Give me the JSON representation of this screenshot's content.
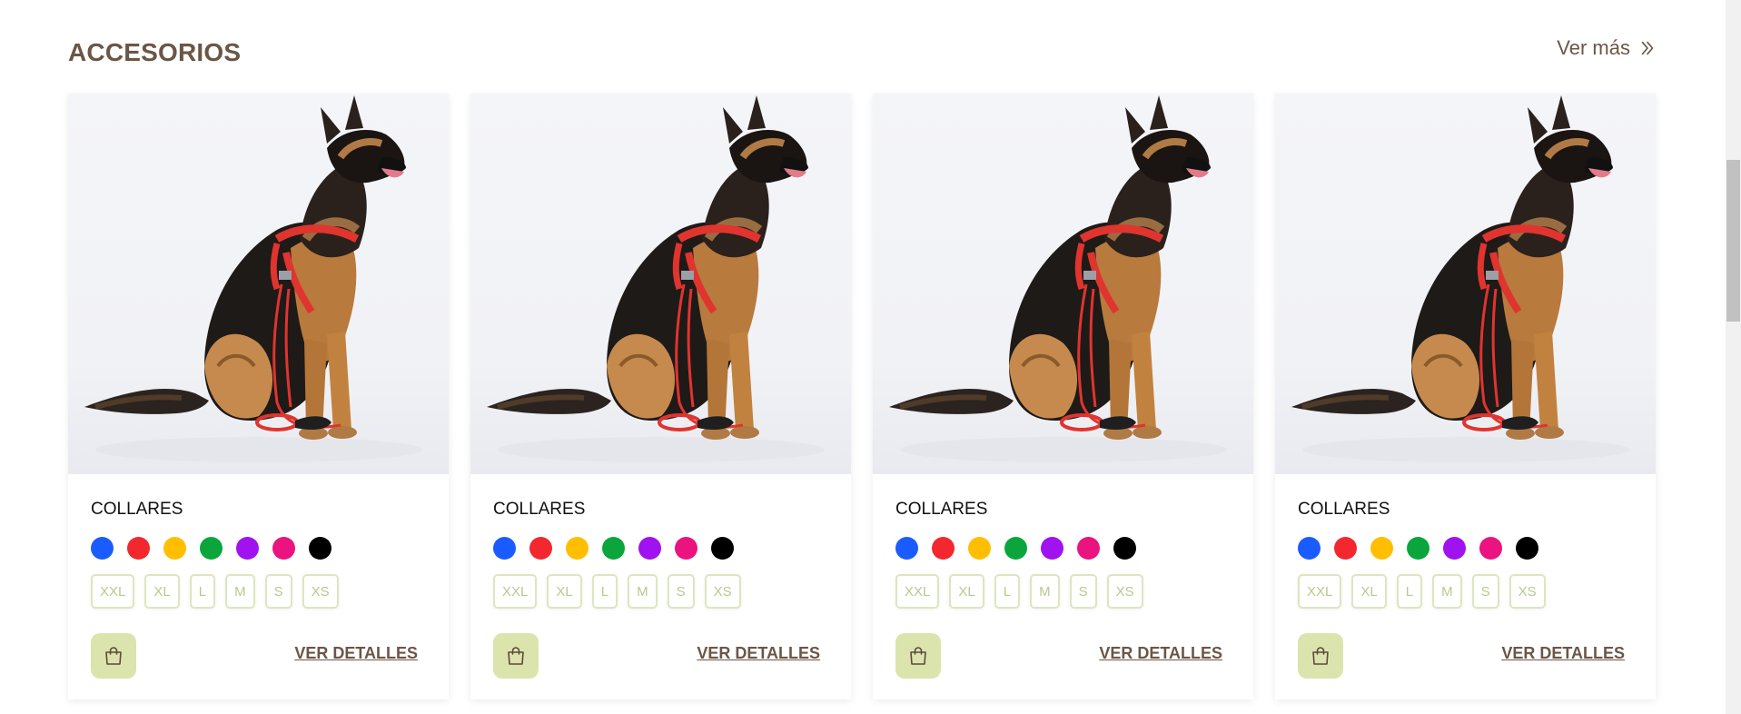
{
  "section": {
    "title": "ACCESORIOS",
    "see_more_label": "Ver más"
  },
  "colors": {
    "brand_brown": "#6b5646",
    "bag_button_bg": "#dbe4ad",
    "size_border": "#dde6bf",
    "size_text": "#b8c98f"
  },
  "products": [
    {
      "category": "COLLARES",
      "swatches": [
        "#1a5cff",
        "#f2282e",
        "#ffbe00",
        "#0aa63c",
        "#a012ef",
        "#ea1380",
        "#000000"
      ],
      "sizes": [
        "XXL",
        "XL",
        "L",
        "M",
        "S",
        "XS"
      ],
      "details_label": "VER DETALLES"
    },
    {
      "category": "COLLARES",
      "swatches": [
        "#1a5cff",
        "#f2282e",
        "#ffbe00",
        "#0aa63c",
        "#a012ef",
        "#ea1380",
        "#000000"
      ],
      "sizes": [
        "XXL",
        "XL",
        "L",
        "M",
        "S",
        "XS"
      ],
      "details_label": "VER DETALLES"
    },
    {
      "category": "COLLARES",
      "swatches": [
        "#1a5cff",
        "#f2282e",
        "#ffbe00",
        "#0aa63c",
        "#a012ef",
        "#ea1380",
        "#000000"
      ],
      "sizes": [
        "XXL",
        "XL",
        "L",
        "M",
        "S",
        "XS"
      ],
      "details_label": "VER DETALLES"
    },
    {
      "category": "COLLARES",
      "swatches": [
        "#1a5cff",
        "#f2282e",
        "#ffbe00",
        "#0aa63c",
        "#a012ef",
        "#ea1380",
        "#000000"
      ],
      "sizes": [
        "XXL",
        "XL",
        "L",
        "M",
        "S",
        "XS"
      ],
      "details_label": "VER DETALLES"
    }
  ],
  "icons": {
    "see_more": "double-chevron-right-icon",
    "bag": "shopping-bag-icon"
  }
}
